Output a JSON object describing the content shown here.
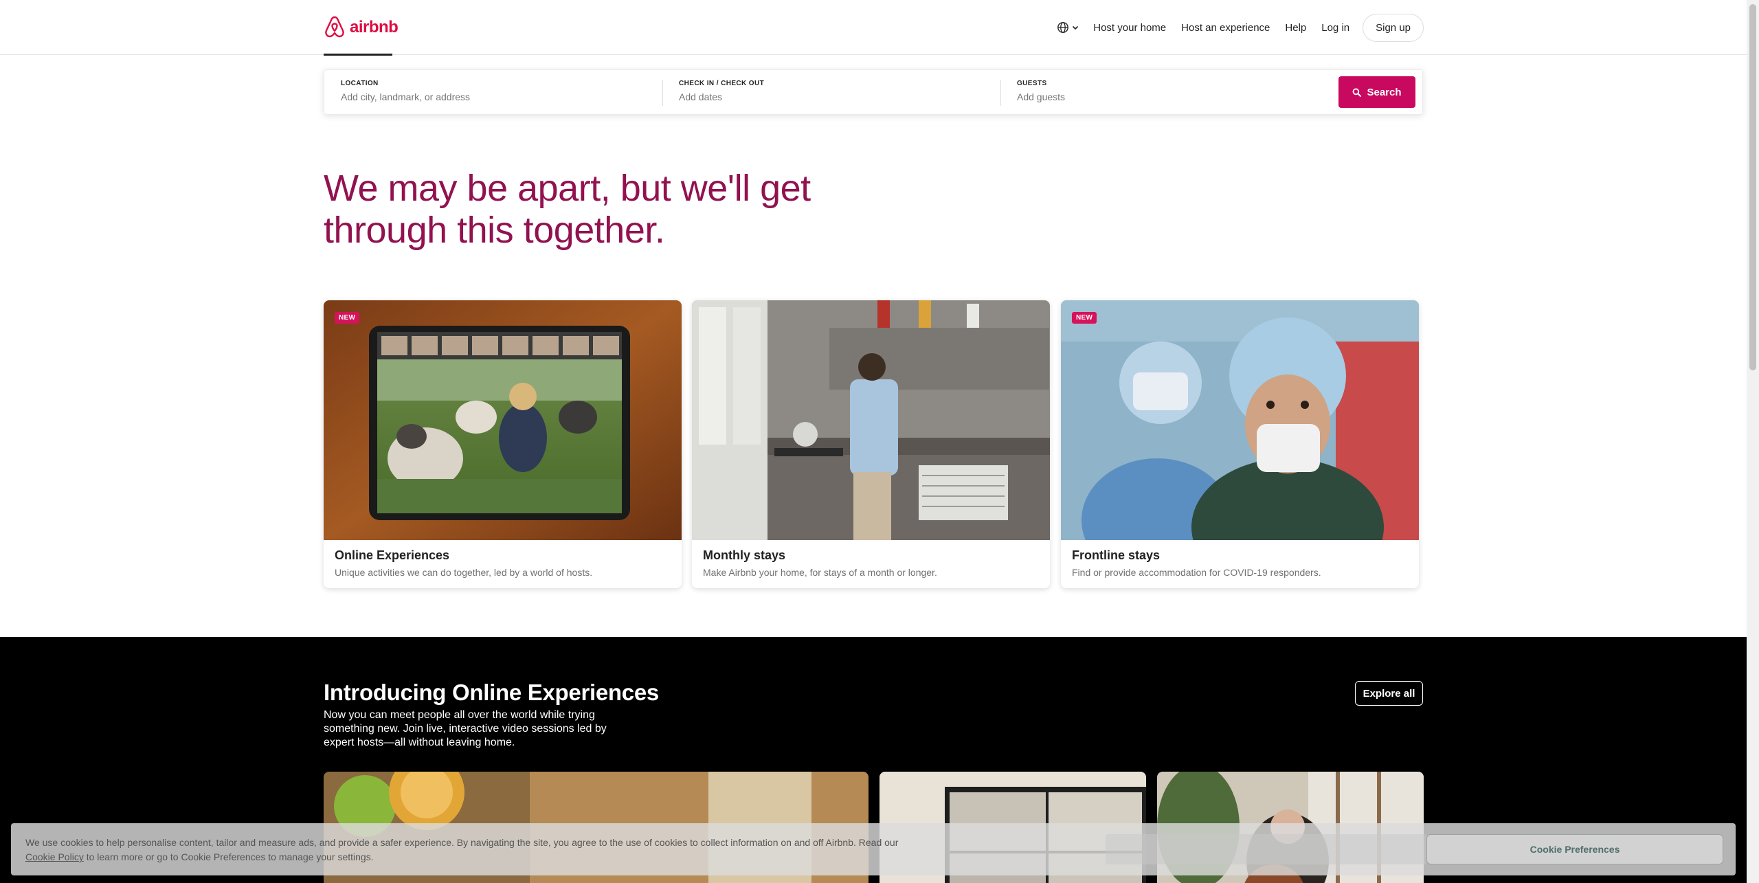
{
  "header": {
    "logo_text": "airbnb",
    "nav": {
      "host_home": "Host your home",
      "host_experience": "Host an experience",
      "help": "Help",
      "login": "Log in",
      "signup": "Sign up"
    }
  },
  "search": {
    "location_label": "LOCATION",
    "location_placeholder": "Add city, landmark, or address",
    "dates_label": "CHECK IN / CHECK OUT",
    "dates_placeholder": "Add dates",
    "guests_label": "GUESTS",
    "guests_placeholder": "Add guests",
    "button_label": "Search"
  },
  "hero": {
    "line1": "We may be apart, but we'll get",
    "line2": "through this together."
  },
  "cards": [
    {
      "badge": "NEW",
      "title": "Online Experiences",
      "description": "Unique activities we can do together, led by a world of hosts."
    },
    {
      "title": "Monthly stays",
      "description": "Make Airbnb your home, for stays of a month or longer."
    },
    {
      "badge": "NEW",
      "title": "Frontline stays",
      "description": "Find or provide accommodation for COVID-19 responders."
    }
  ],
  "online_experiences": {
    "title": "Introducing Online Experiences",
    "description": "Now you can meet people all over the world while trying something new. Join live, interactive video sessions led by expert hosts—all without leaving home.",
    "explore_label": "Explore all"
  },
  "cookie": {
    "text": "We use cookies to help personalise content, tailor and measure ads, and provide a safer experience. By navigating the site, you agree to the use of cookies to collect information on and off Airbnb. Read our",
    "link": "Cookie Policy",
    "text2": "to learn more or go to Cookie Preferences to manage your settings.",
    "preferences_label": "Cookie Preferences"
  },
  "colors": {
    "brand": "#E00B41",
    "search_button": "#C8095F",
    "hero_text": "#921250",
    "badge": "#D5135A"
  }
}
